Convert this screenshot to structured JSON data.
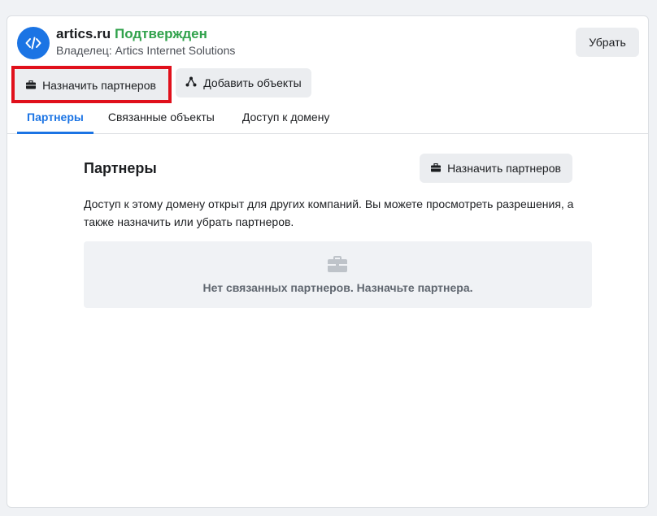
{
  "domain": {
    "name": "artics.ru",
    "status": "Подтвержден",
    "owner": "Владелец: Artics Internet Solutions",
    "icon": "code-icon"
  },
  "header": {
    "remove_label": "Убрать",
    "assign_partners_label": "Назначить партнеров",
    "add_objects_label": "Добавить объекты"
  },
  "tabs": [
    {
      "label": "Партнеры",
      "active": true
    },
    {
      "label": "Связанные объекты",
      "active": false
    },
    {
      "label": "Доступ к домену",
      "active": false
    }
  ],
  "partners_section": {
    "title": "Партнеры",
    "assign_label": "Назначить партнеров",
    "description": "Доступ к этому домену открыт для других компаний. Вы можете просмотреть разрешения, а также назначить или убрать партнеров.",
    "empty_text": "Нет связанных партнеров. Назначьте партнера.",
    "empty_icon": "briefcase-icon"
  },
  "colors": {
    "accent": "#1b74e4",
    "verified": "#31a24c",
    "highlight": "#e0101b"
  }
}
